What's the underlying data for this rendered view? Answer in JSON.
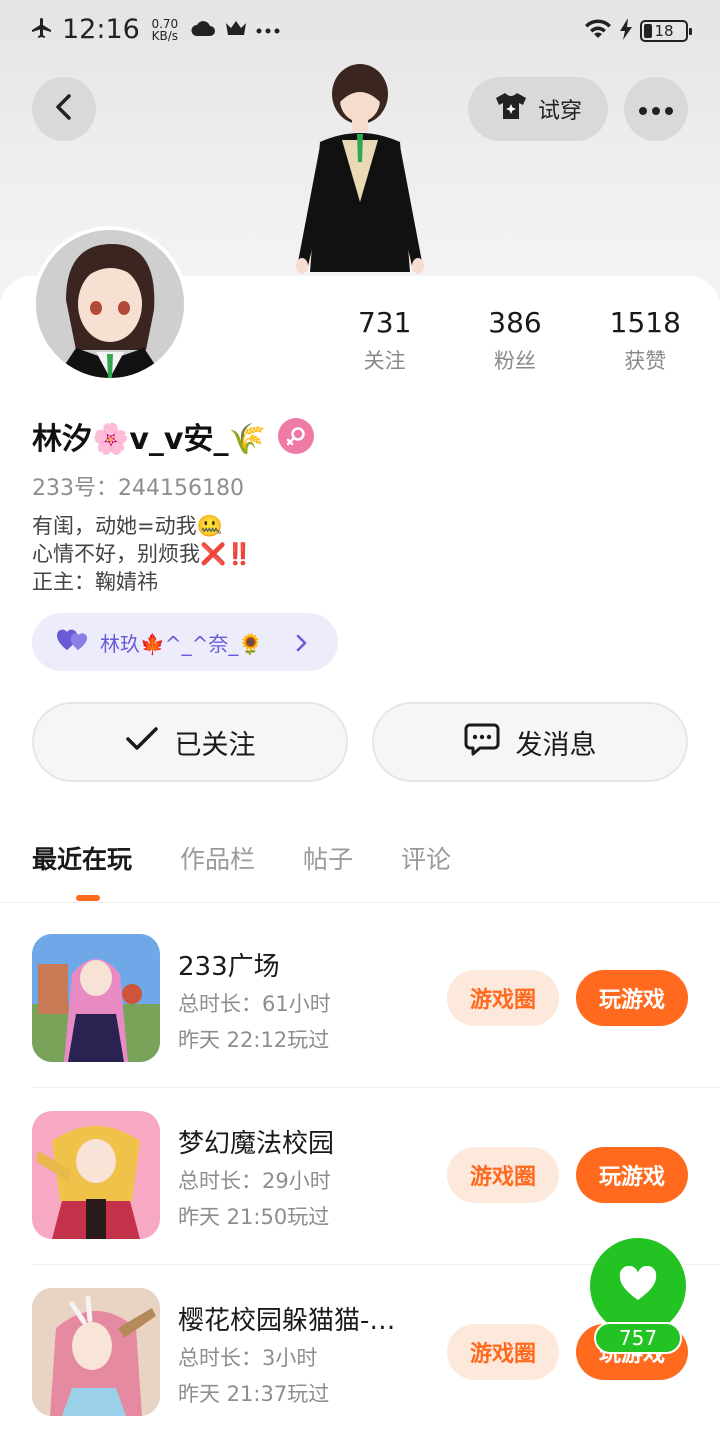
{
  "status_bar": {
    "time": "12:16",
    "speed_value": "0.70",
    "speed_unit": "KB/s",
    "battery": "18",
    "icons": [
      "airplane-icon",
      "cloud-icon",
      "crown-icon",
      "more-dots-icon",
      "wifi-icon",
      "charging-icon",
      "battery-icon"
    ]
  },
  "header": {
    "tryon_label": "试穿"
  },
  "profile": {
    "name": "林汐🌸v_v安_🌾",
    "uid": "233号：244156180",
    "bio": [
      "有闺，动她=动我🤐",
      "心情不好，别烦我❌‼️",
      "正主：鞠婧祎"
    ],
    "cp_label": "林玖🍁^_^奈_🌻",
    "stats": [
      {
        "value": "731",
        "label": "关注"
      },
      {
        "value": "386",
        "label": "粉丝"
      },
      {
        "value": "1518",
        "label": "获赞"
      }
    ]
  },
  "actions": {
    "follow_label": "已关注",
    "message_label": "发消息"
  },
  "tabs": [
    {
      "label": "最近在玩",
      "active": true
    },
    {
      "label": "作品栏",
      "active": false
    },
    {
      "label": "帖子",
      "active": false
    },
    {
      "label": "评论",
      "active": false
    }
  ],
  "games": [
    {
      "title": "233广场",
      "duration": "总时长：61小时",
      "last_played": "昨天 22:12玩过",
      "circle_label": "游戏圈",
      "play_label": "玩游戏"
    },
    {
      "title": "梦幻魔法校园",
      "duration": "总时长：29小时",
      "last_played": "昨天 21:50玩过",
      "circle_label": "游戏圈",
      "play_label": "玩游戏"
    },
    {
      "title": "樱花校园躲猫猫-…",
      "duration": "总时长：3小时",
      "last_played": "昨天 21:37玩过",
      "circle_label": "游戏圈",
      "play_label": "玩游戏"
    }
  ],
  "like": {
    "count": "757"
  },
  "colors": {
    "accent": "#ff6a1f",
    "accent_light": "#fde8dc",
    "like_green": "#22c322",
    "cp_purple": "#6a5ad6",
    "gender_pink": "#f07aa6"
  }
}
